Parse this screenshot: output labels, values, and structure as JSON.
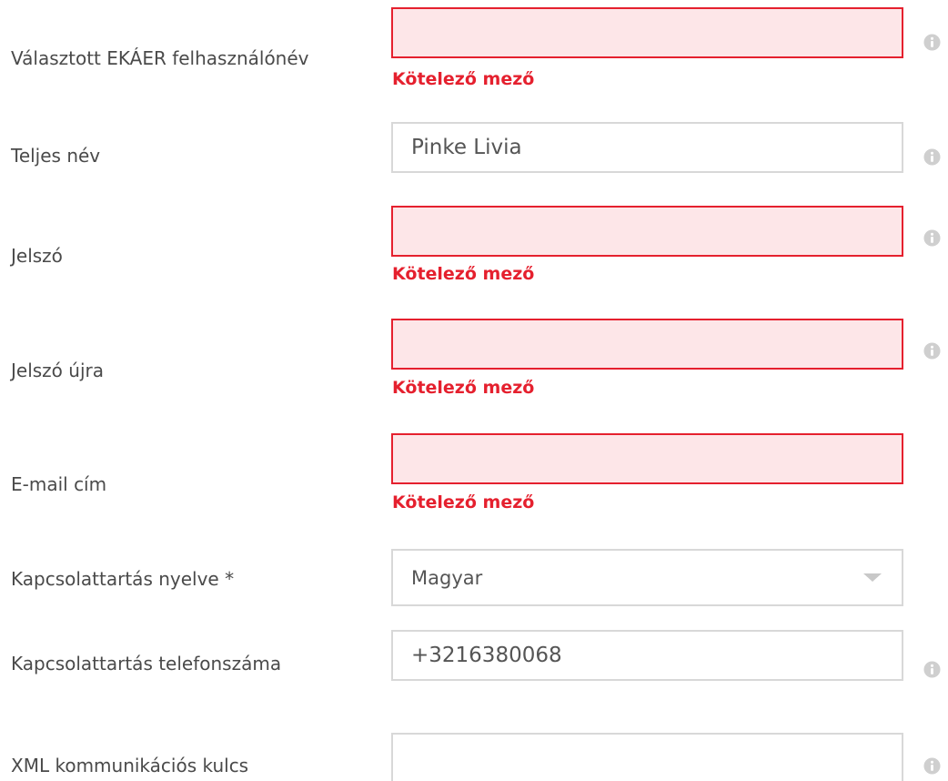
{
  "form": {
    "error_message": "Kötelező mező",
    "fields": [
      {
        "label": "Választott EKÁER felhasználónév",
        "value": "",
        "error": "Kötelező mező"
      },
      {
        "label": "Teljes név",
        "value": "Pinke Livia"
      },
      {
        "label": "Jelszó",
        "value": "",
        "error": "Kötelező mező"
      },
      {
        "label": "Jelszó újra",
        "value": "",
        "error": "Kötelező mező"
      },
      {
        "label": "E-mail cím",
        "value": "",
        "error": "Kötelező mező"
      },
      {
        "label": "Kapcsolattartás nyelve *",
        "selected": "Magyar"
      },
      {
        "label": "Kapcsolattartás telefonszáma",
        "value": "+3216380068"
      },
      {
        "label": "XML kommunikációs kulcs",
        "value": ""
      }
    ]
  },
  "icons": {
    "info": "info-icon",
    "dropdown": "chevron-down-icon"
  },
  "colors": {
    "error": "#e5202e",
    "error_background": "#fde6e8",
    "border": "#d8d8d8",
    "label_text": "#4a4a4a",
    "info_icon": "#cfcfcf"
  }
}
